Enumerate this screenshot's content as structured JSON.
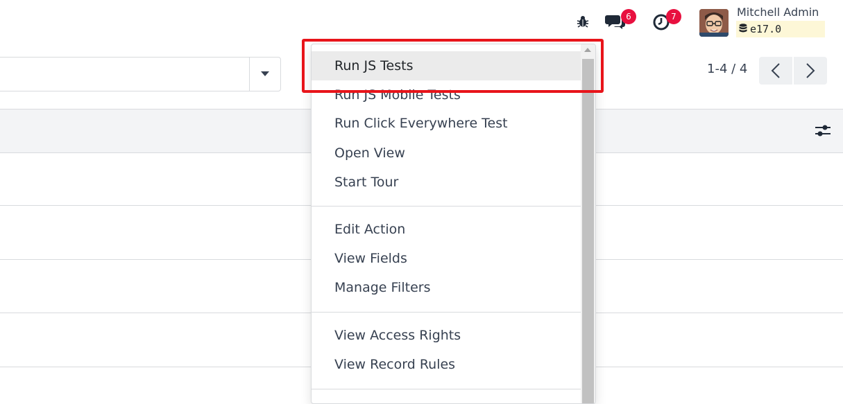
{
  "navbar": {
    "debug_icon": "bug-icon",
    "messages": {
      "icon": "chat-bubbles-icon",
      "count": "6"
    },
    "activities": {
      "icon": "clock-icon",
      "count": "7"
    },
    "user": {
      "name": "Mitchell Admin",
      "database": "e17.0",
      "avatar_icon": "user-avatar"
    }
  },
  "control_panel": {
    "search_toggle_icon": "caret-down-icon",
    "pager": {
      "value": "1-4 / 4",
      "prev_icon": "chevron-left-icon",
      "next_icon": "chevron-right-icon"
    }
  },
  "list": {
    "optional_columns_icon": "sliders-icon"
  },
  "debug_menu": {
    "groups": [
      {
        "items": [
          "Run JS Tests",
          "Run JS Mobile Tests",
          "Run Click Everywhere Test",
          "Open View",
          "Start Tour"
        ]
      },
      {
        "items": [
          "Edit Action",
          "View Fields",
          "Manage Filters"
        ]
      },
      {
        "items": [
          "View Access Rights",
          "View Record Rules"
        ]
      }
    ],
    "active_item": "Run JS Tests"
  },
  "colors": {
    "badge": "#e8103f",
    "highlight": "#e8141a",
    "db_tag_bg": "#fdf7d7",
    "text": "#374151"
  }
}
